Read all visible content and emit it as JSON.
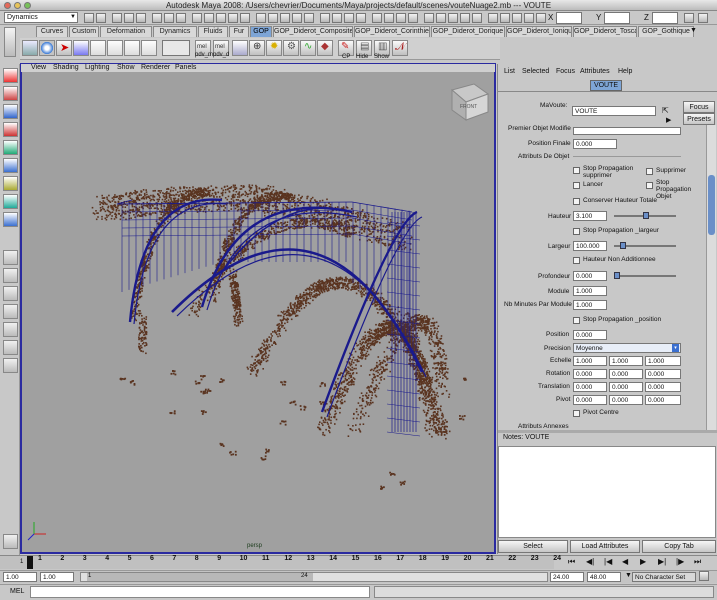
{
  "window": {
    "title": "Autodesk Maya 2008: /Users/chevrier/Documents/Maya/projects/default/scenes/vouteNuage2.mb   ---   VOUTE"
  },
  "statusline": {
    "mode": "Dynamics",
    "x_label": "X",
    "y_label": "Y",
    "z_label": "Z"
  },
  "shelf_tabs": [
    "Curves",
    "Custom",
    "Deformation",
    "Dynamics",
    "Fluids",
    "Fur",
    "GOP",
    "GOP_Diderot_Composite",
    "GOP_Diderot_Corinthien",
    "GOP_Diderot_Dorique",
    "GOP_Diderot_Ionique",
    "GOP_Diderot_Toscan",
    "GOP_Gothique"
  ],
  "active_shelf_tab": "GOP",
  "shelf": {
    "mel1": "mel",
    "mel2": "mel",
    "pdv_label": "pdv_mpdv_d",
    "cp_label": "CP",
    "hide_label": "Hide",
    "show_label": "Show"
  },
  "viewport": {
    "menus": [
      "View",
      "Shading",
      "Lighting",
      "Show",
      "Renderer",
      "Panels"
    ],
    "camera": "persp",
    "viewcube": "FRONT",
    "colors": {
      "background": "#a0a0a0",
      "cloud": "#5a3420",
      "wire": "#1a1a8c"
    }
  },
  "attr_editor": {
    "menus": [
      "List",
      "Selected",
      "Focus",
      "Attributes",
      "Help"
    ],
    "tab": "VOUTE",
    "node_label": "MaVoute:",
    "node_value": "VOUTE",
    "focus_button": "Focus",
    "presets_button": "Presets",
    "cut_label": "Premier Objet Modifie",
    "position_finale_label": "Position Finale",
    "position_finale_value": "0.000",
    "attributs_header": "Attributs De Objet",
    "stop_prop_supprimer": "Stop Propagation supprimer",
    "supprimer": "Supprimer",
    "lancer": "Lancer",
    "stop_prop_objet": "Stop Propagation Objet",
    "conserver_hauteur": "Conserver Hauteur Totale",
    "hauteur_label": "Hauteur",
    "hauteur_value": "3.100",
    "stop_prop_largeur": "Stop Propagation _largeur",
    "largeur_label": "Largeur",
    "largeur_value": "100.000",
    "hauteur_non_add": "Hauteur Non Additionnee",
    "profondeur_label": "Profondeur",
    "profondeur_value": "0.000",
    "module_label": "Module",
    "module_value": "1.000",
    "nb_minutes_label": "Nb Minutes Par Module",
    "nb_minutes_value": "1.000",
    "stop_prop_position": "Stop Propagation _position",
    "position_label": "Position",
    "position_value": "0.000",
    "precision_label": "Precision",
    "precision_value": "Moyenne",
    "echelle_label": "Echelle",
    "echelle": [
      "1.000",
      "1.000",
      "1.000"
    ],
    "rotation_label": "Rotation",
    "rotation": [
      "0.000",
      "0.000",
      "0.000"
    ],
    "translation_label": "Translation",
    "translation": [
      "0.000",
      "0.000",
      "0.000"
    ],
    "pivot_label": "Pivot",
    "pivot": [
      "0.000",
      "0.000",
      "0.000"
    ],
    "pivot_centre": "Pivot Centre",
    "attributs_annexes": "Attributs Annexes",
    "notes_label": "Notes:  VOUTE",
    "select_button": "Select",
    "load_button": "Load Attributes",
    "copy_tab_button": "Copy Tab"
  },
  "timeline": {
    "ticks": [
      "1",
      "2",
      "3",
      "4",
      "5",
      "6",
      "7",
      "8",
      "9",
      "10",
      "11",
      "12",
      "13",
      "14",
      "15",
      "16",
      "17",
      "18",
      "19",
      "20",
      "21",
      "22",
      "23",
      "24"
    ],
    "current": "1"
  },
  "range": {
    "start": "1.00",
    "start2": "1.00",
    "range_start": "1",
    "range_end": "24",
    "end": "24.00",
    "end2": "48.00",
    "char_set": "No Character Set"
  },
  "cmdline": {
    "label": "MEL"
  }
}
